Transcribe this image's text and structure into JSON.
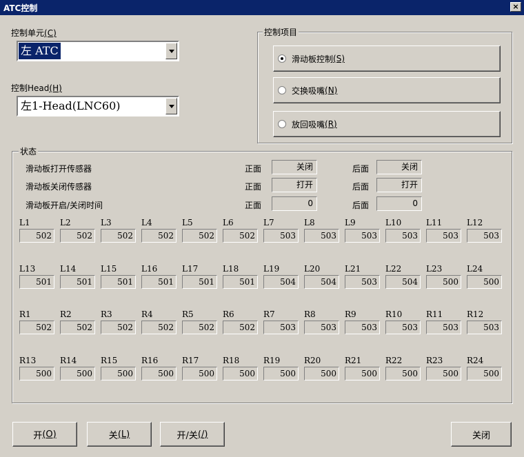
{
  "window": {
    "title": "ATC控制",
    "close_glyph": "×"
  },
  "control_unit": {
    "label": "控制单元",
    "mnemonic": "(C)",
    "value": "左 ATC"
  },
  "control_head": {
    "label": "控制Head",
    "mnemonic": "(H)",
    "value": "左1-Head(LNC60)"
  },
  "control_items": {
    "title": "控制项目",
    "options": [
      {
        "label": "滑动板控制",
        "mnemonic": "(S)",
        "checked": true
      },
      {
        "label": "交换吸嘴",
        "mnemonic": "(N)",
        "checked": false
      },
      {
        "label": "放回吸嘴",
        "mnemonic": "(R)",
        "checked": false
      }
    ]
  },
  "status": {
    "title": "状态",
    "rows": [
      {
        "label": "滑动板打开传感器",
        "front_label": "正面",
        "front": "关闭",
        "back_label": "后面",
        "back": "关闭"
      },
      {
        "label": "滑动板关闭传感器",
        "front_label": "正面",
        "front": "打开",
        "back_label": "后面",
        "back": "打开"
      },
      {
        "label": "滑动板开启/关闭时间",
        "front_label": "正面",
        "front": "0",
        "back_label": "后面",
        "back": "0"
      }
    ],
    "grids": [
      [
        {
          "l": "L1",
          "v": "502"
        },
        {
          "l": "L2",
          "v": "502"
        },
        {
          "l": "L3",
          "v": "502"
        },
        {
          "l": "L4",
          "v": "502"
        },
        {
          "l": "L5",
          "v": "502"
        },
        {
          "l": "L6",
          "v": "502"
        },
        {
          "l": "L7",
          "v": "503"
        },
        {
          "l": "L8",
          "v": "503"
        },
        {
          "l": "L9",
          "v": "503"
        },
        {
          "l": "L10",
          "v": "503"
        },
        {
          "l": "L11",
          "v": "503"
        },
        {
          "l": "L12",
          "v": "503"
        }
      ],
      [
        {
          "l": "L13",
          "v": "501"
        },
        {
          "l": "L14",
          "v": "501"
        },
        {
          "l": "L15",
          "v": "501"
        },
        {
          "l": "L16",
          "v": "501"
        },
        {
          "l": "L17",
          "v": "501"
        },
        {
          "l": "L18",
          "v": "501"
        },
        {
          "l": "L19",
          "v": "504"
        },
        {
          "l": "L20",
          "v": "504"
        },
        {
          "l": "L21",
          "v": "503"
        },
        {
          "l": "L22",
          "v": "504"
        },
        {
          "l": "L23",
          "v": "500"
        },
        {
          "l": "L24",
          "v": "500"
        }
      ],
      [
        {
          "l": "R1",
          "v": "502"
        },
        {
          "l": "R2",
          "v": "502"
        },
        {
          "l": "R3",
          "v": "502"
        },
        {
          "l": "R4",
          "v": "502"
        },
        {
          "l": "R5",
          "v": "502"
        },
        {
          "l": "R6",
          "v": "502"
        },
        {
          "l": "R7",
          "v": "503"
        },
        {
          "l": "R8",
          "v": "503"
        },
        {
          "l": "R9",
          "v": "503"
        },
        {
          "l": "R10",
          "v": "503"
        },
        {
          "l": "R11",
          "v": "503"
        },
        {
          "l": "R12",
          "v": "503"
        }
      ],
      [
        {
          "l": "R13",
          "v": "500"
        },
        {
          "l": "R14",
          "v": "500"
        },
        {
          "l": "R15",
          "v": "500"
        },
        {
          "l": "R16",
          "v": "500"
        },
        {
          "l": "R17",
          "v": "500"
        },
        {
          "l": "R18",
          "v": "500"
        },
        {
          "l": "R19",
          "v": "500"
        },
        {
          "l": "R20",
          "v": "500"
        },
        {
          "l": "R21",
          "v": "500"
        },
        {
          "l": "R22",
          "v": "500"
        },
        {
          "l": "R23",
          "v": "500"
        },
        {
          "l": "R24",
          "v": "500"
        }
      ]
    ]
  },
  "buttons": {
    "open": {
      "label": "开",
      "mnemonic": "(O)"
    },
    "shut": {
      "label": "关",
      "mnemonic": "(L)"
    },
    "toggle": {
      "label": "开/关",
      "mnemonic": "(/)"
    },
    "close": {
      "label": "关闭"
    }
  }
}
